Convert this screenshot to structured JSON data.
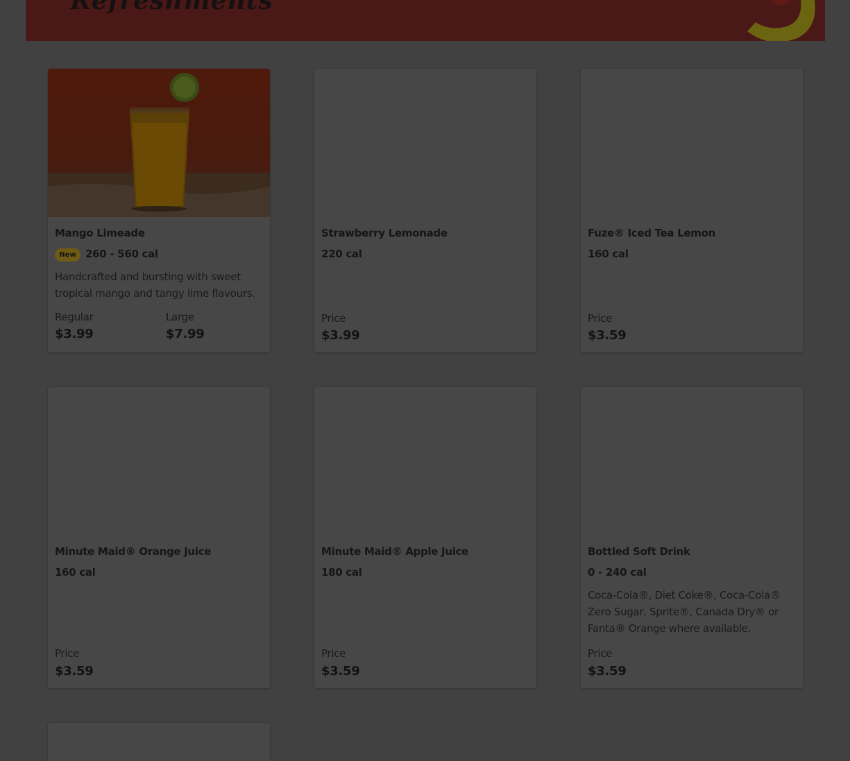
{
  "banner": {
    "title": "Refreshments",
    "background": "#4b1818",
    "accent": "#6b6410"
  },
  "badge_colors": {
    "new": "#6e5c15"
  },
  "items": [
    {
      "name": "Mango Limeade",
      "badge": "New",
      "calories": "260 - 560 cal",
      "description": "Handcrafted and bursting with sweet tropical mango and tangy lime flavours.",
      "prices": [
        {
          "label": "Regular",
          "value": "$3.99"
        },
        {
          "label": "Large",
          "value": "$7.99"
        }
      ],
      "image": "mango-limeade-glass-photo"
    },
    {
      "name": "Strawberry Lemonade",
      "calories": "220 cal",
      "prices": [
        {
          "label": "Price",
          "value": "$3.99"
        }
      ]
    },
    {
      "name": "Fuze® Iced Tea Lemon",
      "calories": "160 cal",
      "prices": [
        {
          "label": "Price",
          "value": "$3.59"
        }
      ]
    },
    {
      "name": "Minute Maid® Orange Juice",
      "calories": "160 cal",
      "prices": [
        {
          "label": "Price",
          "value": "$3.59"
        }
      ]
    },
    {
      "name": "Minute Maid® Apple Juice",
      "calories": "180 cal",
      "prices": [
        {
          "label": "Price",
          "value": "$3.59"
        }
      ]
    },
    {
      "name": "Bottled Soft Drink",
      "calories": "0 - 240 cal",
      "description": "Coca-Cola®, Diet Coke®, Coca-Cola® Zero Sugar, Sprite®, Canada Dry® or Fanta® Orange where available.",
      "prices": [
        {
          "label": "Price",
          "value": "$3.59"
        }
      ]
    }
  ]
}
